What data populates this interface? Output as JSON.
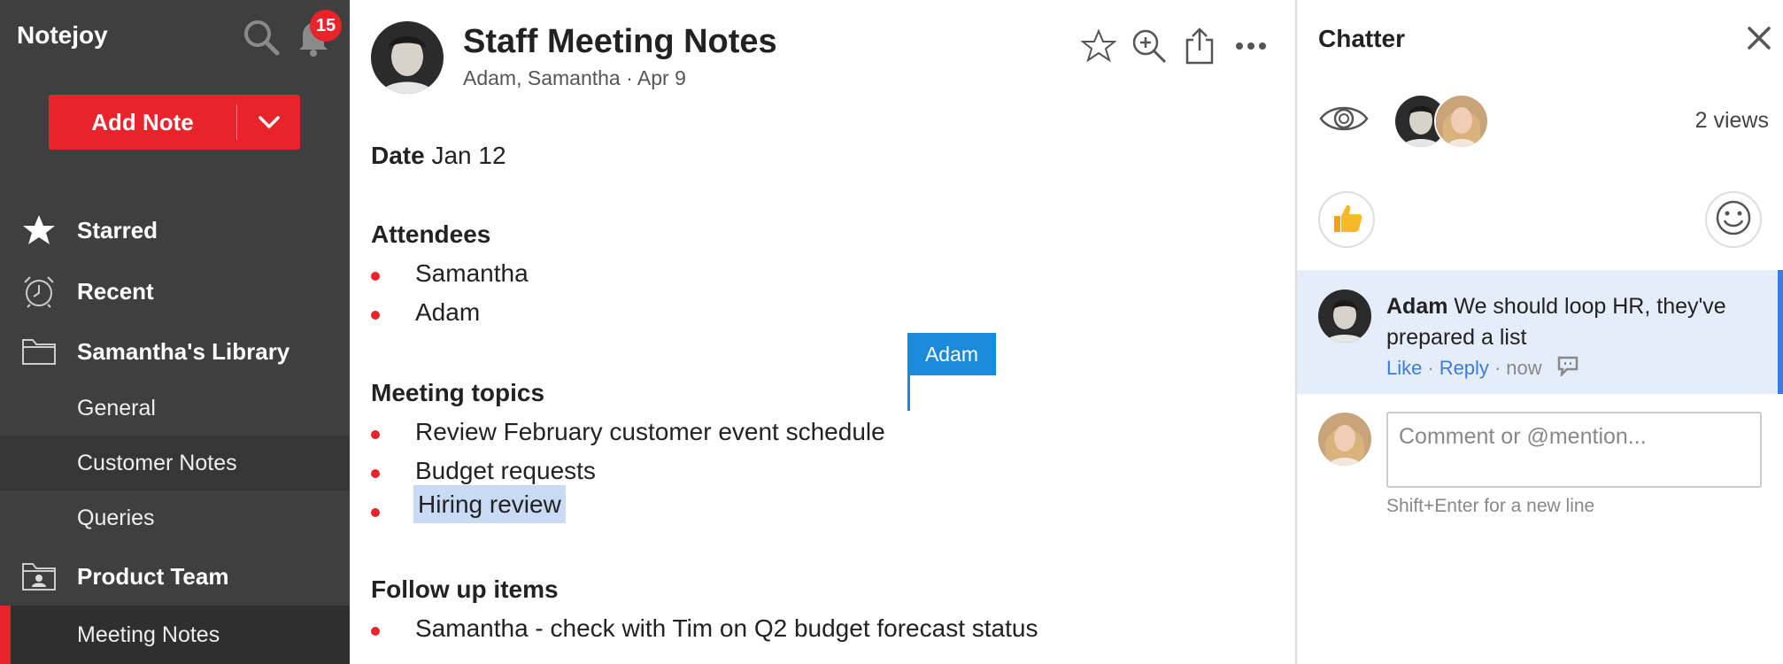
{
  "sidebar": {
    "brand": "Notejoy",
    "notification_count": "15",
    "add_note_label": "Add Note",
    "items": [
      {
        "label": "Starred",
        "icon": "star-icon"
      },
      {
        "label": "Recent",
        "icon": "alarm-clock-icon"
      },
      {
        "label": "Samantha's Library",
        "icon": "folder-icon"
      },
      {
        "label": "General"
      },
      {
        "label": "Customer Notes"
      },
      {
        "label": "Queries"
      },
      {
        "label": "Product Team",
        "icon": "shared-folder-icon"
      },
      {
        "label": "Meeting Notes"
      }
    ]
  },
  "note": {
    "title": "Staff Meeting Notes",
    "meta": "Adam, Samantha · Apr 9",
    "date_label": "Date",
    "date_value": "Jan 12",
    "attendees_heading": "Attendees",
    "attendees": [
      "Samantha",
      "Adam"
    ],
    "topics_heading": "Meeting topics",
    "topics": [
      "Review February customer event schedule",
      "Budget requests",
      "Hiring review"
    ],
    "followup_heading": "Follow up items",
    "followups": [
      "Samantha - check with Tim on Q2 budget forecast status"
    ],
    "collaborator_cursor": "Adam"
  },
  "chatter": {
    "title": "Chatter",
    "views": "2 views",
    "comment": {
      "author": "Adam",
      "text": "We should loop HR, they've prepared a list",
      "like": "Like",
      "reply": "Reply",
      "time": "now"
    },
    "input_placeholder": "Comment or @mention...",
    "hint": "Shift+Enter for a new line"
  },
  "colors": {
    "accent_red": "#e8232a",
    "sidebar_bg": "#3f3f3f",
    "link_blue": "#3c7be0",
    "cursor_blue": "#1a8ad9",
    "comment_bg": "#e5ecfa",
    "selection_bg": "#c9daf4"
  }
}
